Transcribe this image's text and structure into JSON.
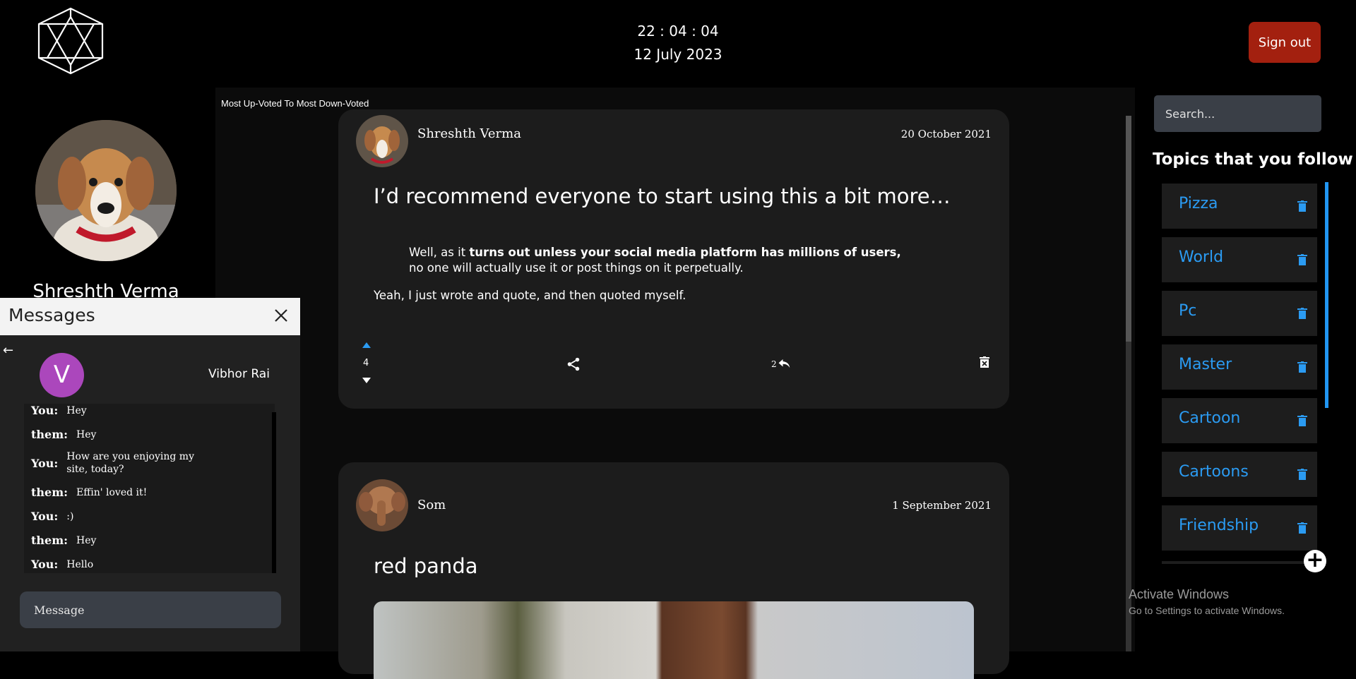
{
  "header": {
    "time": "22 : 04 : 04",
    "date": "12 July 2023",
    "signout_label": "Sign out"
  },
  "profile": {
    "name": "Shreshth Verma"
  },
  "feed": {
    "sort_label": "Most Up-Voted To Most Down-Voted",
    "posts": [
      {
        "author": "Shreshth Verma",
        "date": "20 October 2021",
        "title": "I’d recommend everyone to start using this a bit more…",
        "quote_plain_1": "Well, as it ",
        "quote_bold": "turns out unless your social media platform has millions of users,",
        "quote_plain_2": " no one will actually use it or post things on it perpetually.",
        "body": "Yeah, I just wrote and quote, and then quoted myself.",
        "votes": "4",
        "replies": "2"
      },
      {
        "author": "Som",
        "date": "1 September 2021",
        "title": "red panda"
      }
    ]
  },
  "sidebar": {
    "search_placeholder": "Search...",
    "topics_heading": "Topics that you follow",
    "topics": [
      "Pizza",
      "World",
      "Pc",
      "Master",
      "Cartoon",
      "Cartoons",
      "Friendship"
    ]
  },
  "messages": {
    "title": "Messages",
    "contact_initial": "V",
    "contact_name": "Vibhor Rai",
    "chat": [
      {
        "who": "You:",
        "text": "Hey"
      },
      {
        "who": "them:",
        "text": "Hey"
      },
      {
        "who": "You:",
        "text": "How are you enjoying my site, today?"
      },
      {
        "who": "them:",
        "text": "Effin' loved it!"
      },
      {
        "who": "You:",
        "text": ":)"
      },
      {
        "who": "them:",
        "text": "Hey"
      },
      {
        "who": "You:",
        "text": "Hello"
      }
    ],
    "input_placeholder": "Message"
  },
  "watermark": {
    "line1": "Activate Windows",
    "line2": "Go to Settings to activate Windows."
  },
  "colors": {
    "accent": "#2b9bf2",
    "signout": "#a3200f",
    "contact_avatar": "#ab47bc"
  }
}
